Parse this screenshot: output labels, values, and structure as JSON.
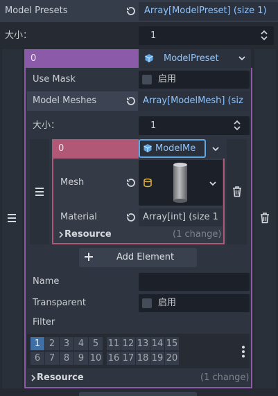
{
  "model_presets": {
    "label": "Model Presets",
    "value": "Array[ModelPreset] (size 1)",
    "size_label": "大小：",
    "size_value": "1"
  },
  "preset": {
    "index": "0",
    "type_name": "ModelPreset",
    "use_mask_label": "Use Mask",
    "use_mask_value": "启用",
    "model_meshes_label": "Model Meshes",
    "model_meshes_value": "Array[ModelMesh] (siz",
    "meshes_size_label": "大小：",
    "meshes_size_value": "1",
    "add_element_label": "Add Element",
    "name_label": "Name",
    "name_value": "",
    "transparent_label": "Transparent",
    "transparent_value": "启用",
    "filter_label": "Filter",
    "filter_numbers_row1": [
      "1",
      "2",
      "3",
      "4",
      "5",
      "11",
      "12",
      "13",
      "14",
      "15"
    ],
    "filter_numbers_row2": [
      "6",
      "7",
      "8",
      "9",
      "10",
      "16",
      "17",
      "18",
      "19",
      "20"
    ],
    "filter_selected": "1",
    "resource_label": "Resource",
    "resource_changes": "(1 change)"
  },
  "mesh_item": {
    "index": "0",
    "type_name": "ModelMe",
    "mesh_label": "Mesh",
    "material_label": "Material",
    "material_value": "Array[int] (size 1",
    "resource_label": "Resource",
    "resource_changes": "(1 change)"
  },
  "colors": {
    "background": "#252a33",
    "preset_accent": "#8b5aa8",
    "mesh_accent": "#b25877",
    "selected_blue": "#3e6fa6",
    "link_text": "#8fc4ff"
  },
  "icons": [
    "revert-icon",
    "cube-icon",
    "chevron-down-icon",
    "drag-handle-icon",
    "trash-icon",
    "plus-icon",
    "cylinder-icon",
    "kebab-menu-icon",
    "checkbox-icon",
    "chevron-right-icon",
    "updown-icon"
  ]
}
